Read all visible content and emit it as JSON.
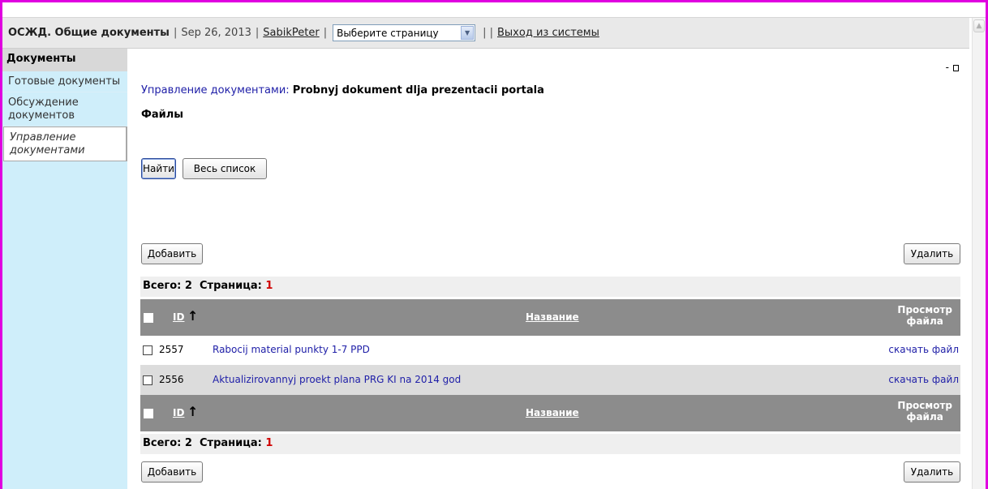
{
  "header": {
    "app_title": "ОСЖД. Общие документы",
    "sep": "|",
    "date": "Sep 26, 2013",
    "user": "SabikPeter",
    "page_select": "Выберите страницу",
    "sep2": "| |",
    "logout": "Выход из системы"
  },
  "sidebar": {
    "heading": "Документы",
    "items": [
      {
        "label": "Готовые документы"
      },
      {
        "label": "Обсуждение документов"
      },
      {
        "label": "Управление документами"
      }
    ]
  },
  "main": {
    "window_minimize": "-",
    "breadcrumb_link": "Управление документами:",
    "breadcrumb_doc": "Probnyj dokument dlja prezentacii portala",
    "section_title": "Файлы",
    "find_button": "Найти",
    "all_list_button": "Весь список",
    "add_button": "Добавить",
    "delete_button": "Удалить",
    "total_label": "Всего:",
    "total_value": "2",
    "page_label": "Страница:",
    "page_value": "1"
  },
  "table": {
    "col_id": "ID",
    "sort_arrow": "↑",
    "col_name": "Название",
    "col_view_line1": "Просмотр",
    "col_view_line2": "файла",
    "rows": [
      {
        "id": "2557",
        "title": "Rabocij material punkty 1-7 PPD",
        "download": "скачать файл"
      },
      {
        "id": "2556",
        "title": "Aktualizirovannyj proekt plana PRG KI na 2014 god",
        "download": "скачать файл"
      }
    ]
  },
  "colors": {
    "frame": "#e000e0",
    "sidebar_bg": "#cfeefa",
    "table_header_bg": "#8c8c8c",
    "link": "#2020a8",
    "page_number": "#d00000"
  }
}
